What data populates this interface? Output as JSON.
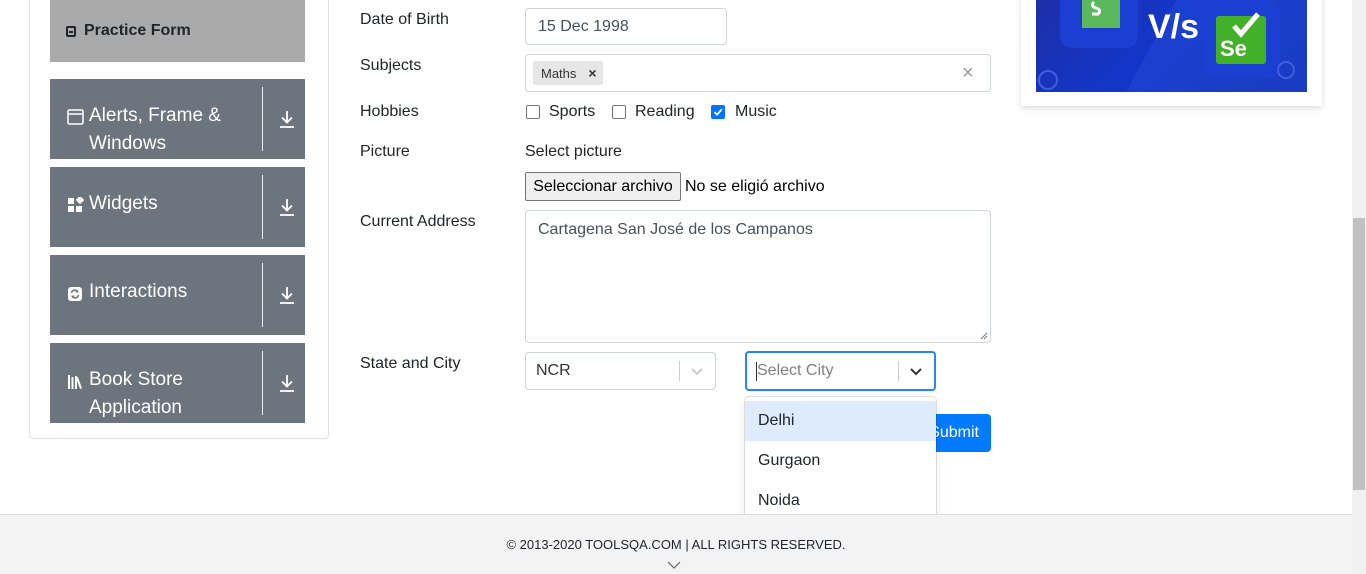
{
  "sidebar": {
    "practice_form": "Practice Form",
    "groups": [
      {
        "label": "Alerts, Frame & Windows",
        "line1": "Alerts, Frame &",
        "line2": "Windows"
      },
      {
        "label": "Widgets"
      },
      {
        "label": "Interactions"
      },
      {
        "label": "Book Store Application",
        "line1": "Book Store",
        "line2": "Application"
      }
    ]
  },
  "form": {
    "dob_label": "Date of Birth",
    "dob_value": "15 Dec 1998",
    "subjects_label": "Subjects",
    "subject_chip": "Maths",
    "chip_remove": "×",
    "subjects_clear": "×",
    "hobbies_label": "Hobbies",
    "hobbies": [
      {
        "label": "Sports",
        "checked": false
      },
      {
        "label": "Reading",
        "checked": false
      },
      {
        "label": "Music",
        "checked": true
      }
    ],
    "picture_label": "Picture",
    "select_picture": "Select picture",
    "file_button": "Seleccionar archivo",
    "file_status": "No se eligió archivo",
    "address_label": "Current Address",
    "address_value": "Cartagena San José de los Campanos",
    "state_city_label": "State and City",
    "state_value": "NCR",
    "city_placeholder": "Select City",
    "city_options": [
      "Delhi",
      "Gurgaon",
      "Noida"
    ],
    "submit_label": "Submit"
  },
  "footer": {
    "text": "© 2013-2020 TOOLSQA.COM | ALL RIGHTS RESERVED."
  },
  "colors": {
    "accent": "#007bff",
    "focus": "#2684ff",
    "sidebar_group": "#6c757d",
    "sidebar_active": "#aaaaaa",
    "ad_blue": "#1336c9"
  }
}
